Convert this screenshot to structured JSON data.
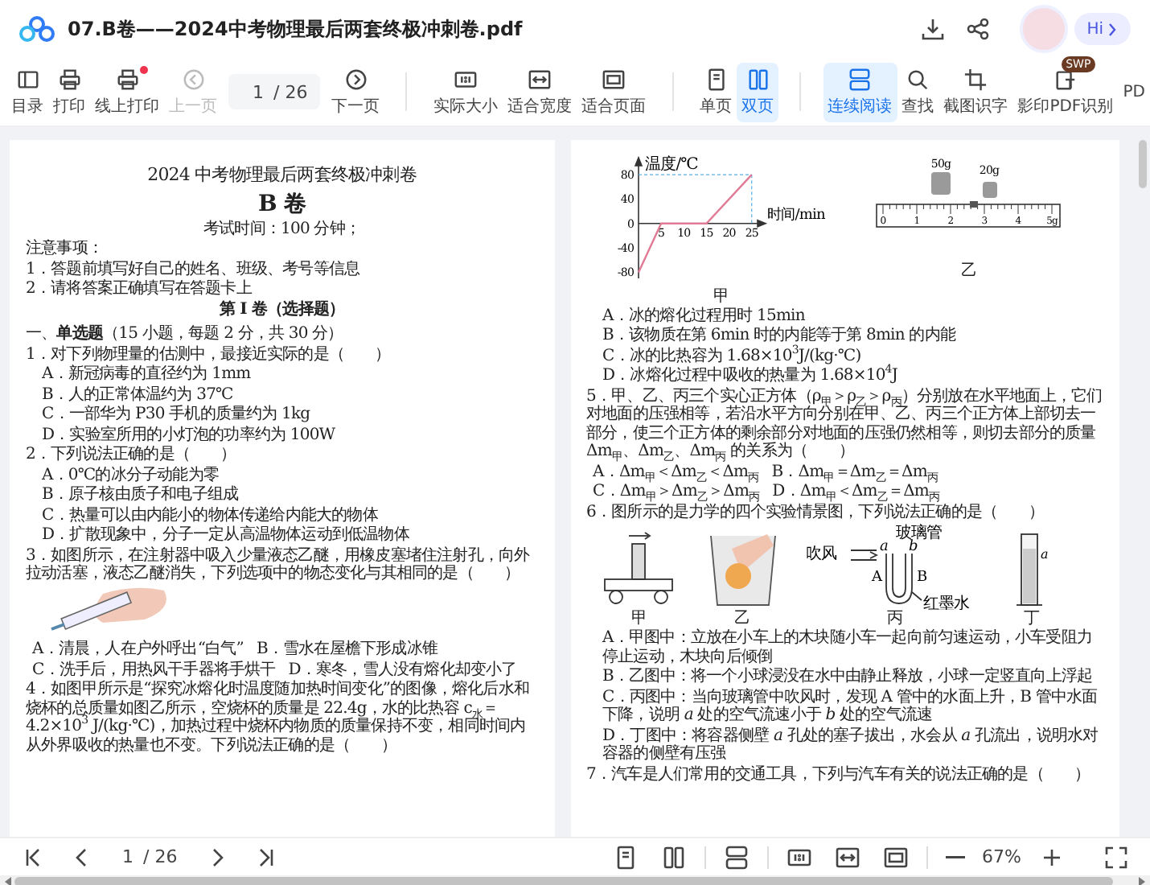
{
  "window": {
    "title": "07.B卷——2024中考物理最后两套终极冲刺卷.pdf",
    "greeting": "Hi"
  },
  "toolbar_groups": [
    {
      "items": [
        {
          "kind": "contents",
          "label": "目录",
          "selected": false,
          "disabled": false
        },
        {
          "kind": "print",
          "label": "打印",
          "selected": false,
          "disabled": false
        },
        {
          "kind": "online-print",
          "label": "线上打印",
          "selected": false,
          "disabled": false,
          "notified": true
        },
        {
          "kind": "prev",
          "label": "上一页",
          "selected": false,
          "disabled": true
        },
        {
          "kind": "pagefield",
          "value": "1",
          "total": "/ 26"
        },
        {
          "kind": "next",
          "label": "下一页",
          "selected": false,
          "disabled": false
        }
      ]
    },
    {
      "items": [
        {
          "kind": "actual-size",
          "label": "实际大小",
          "selected": false,
          "disabled": false
        },
        {
          "kind": "fit-width",
          "label": "适合宽度",
          "selected": false,
          "disabled": false
        },
        {
          "kind": "fit-page",
          "label": "适合页面",
          "selected": false,
          "disabled": false
        }
      ]
    },
    {
      "items": [
        {
          "kind": "single",
          "label": "单页",
          "selected": false,
          "disabled": false
        },
        {
          "kind": "double",
          "label": "双页",
          "selected": true,
          "disabled": false
        }
      ]
    },
    {
      "items": [
        {
          "kind": "continuous",
          "label": "连续阅读",
          "selected": true,
          "disabled": false
        },
        {
          "kind": "find",
          "label": "查找",
          "selected": false,
          "disabled": false
        },
        {
          "kind": "ocr",
          "label": "截图识字",
          "selected": false,
          "disabled": false
        },
        {
          "kind": "copy-ocr",
          "label": "影印PDF识别",
          "selected": false,
          "disabled": false,
          "badge": "SWP"
        },
        {
          "kind": "cut",
          "label": "PD",
          "selected": false,
          "disabled": false
        }
      ]
    }
  ],
  "left_page": [
    {
      "kind": "title",
      "text": "2024 中考物理最后两套终极冲刺卷"
    },
    {
      "kind": "subtitle",
      "text": "B 卷"
    },
    {
      "kind": "meta",
      "text": "考试时间：100 分钟；"
    },
    {
      "kind": "text",
      "text": "注意事项："
    },
    {
      "kind": "text",
      "text": "1．答题前填写好自己的姓名、班级、考号等信息"
    },
    {
      "kind": "text",
      "text": "2．请将答案正确填写在答题卡上"
    },
    {
      "kind": "section",
      "text": "第 I 卷（选择题）"
    },
    {
      "kind": "heading",
      "text": "一、**单选题**（15 小题，每题 2 分，共 30 分）"
    },
    {
      "kind": "question",
      "text": "1．对下列物理量的估测中，最接近实际的是（　　）"
    },
    {
      "kind": "option",
      "text": "A．新冠病毒的直径约为 1mm"
    },
    {
      "kind": "option",
      "text": "B．人的正常体温约为 37℃"
    },
    {
      "kind": "option",
      "text": "C．一部华为 P30 手机的质量约为 1kg"
    },
    {
      "kind": "option",
      "text": "D．实验室所用的小灯泡的功率约为 100W"
    },
    {
      "kind": "question",
      "text": "2．下列说法正确的是（　　）"
    },
    {
      "kind": "option",
      "text": "A．0℃的冰分子动能为零"
    },
    {
      "kind": "option",
      "text": "B．原子核由质子和电子组成"
    },
    {
      "kind": "option",
      "text": "C．热量可以由内能小的物体传递给内能大的物体"
    },
    {
      "kind": "option",
      "text": "D．扩散现象中，分子一定从高温物体运动到低温物体"
    },
    {
      "kind": "question",
      "text": "3．如图所示，在注射器中吸入少量液态乙醚，用橡皮塞堵住注射孔，向外拉动活塞，液态乙醚消失，下列选项中的物态变化与其相同的是（　　）"
    },
    {
      "kind": "syringe"
    },
    {
      "kind": "option-pair",
      "texts": [
        "A．清晨，人在户外呼出“白气”",
        "B．雪水在屋檐下形成冰锥"
      ]
    },
    {
      "kind": "option-pair",
      "texts": [
        "C．洗手后，用热风干手器将手烘干",
        "D．寒冬，雪人没有熔化却变小了"
      ]
    },
    {
      "kind": "question",
      "text": "4．如图甲所示是“探究冰熔化时温度随加热时间变化”的图像，熔化后水和烧杯的总质量如图乙所示，空烧杯的质量是 22.4g，水的比热容 c$_{水}$＝4.2×10$^{3}$ J/(kg·℃)，加热过程中烧杯内物质的质量保持不变，相同时间内从外界吸收的热量也不变。下列说法正确的是（　　）"
    }
  ],
  "right_page": [
    {
      "kind": "q4-figures",
      "chart_caption": "甲",
      "chart_data": {
        "type": "line",
        "xlabel": "时间/min",
        "ylabel": "温度/℃",
        "x": [
          0,
          5,
          15,
          25
        ],
        "series": [
          {
            "color": "#e07a95",
            "values": [
              -80,
              0,
              0,
              80
            ]
          }
        ],
        "xticks": [
          5,
          10,
          15,
          20,
          25
        ],
        "yticks": [
          -80,
          -40,
          0,
          40,
          80
        ],
        "xlim": [
          0,
          27
        ],
        "ylim": [
          -90,
          100
        ],
        "ref_lines": [
          {
            "axis": "y",
            "value": 80
          },
          {
            "axis": "x",
            "value": 25
          }
        ]
      },
      "weights": [
        "50g",
        "20g"
      ],
      "ruler_marks": [
        "0",
        "1",
        "2",
        "3",
        "4",
        "5g"
      ],
      "scale_caption": "乙"
    },
    {
      "kind": "option",
      "text": "A．冰的熔化过程用时 15min"
    },
    {
      "kind": "option",
      "text": "B．该物质在第 6min 时的内能等于第 8min 的内能"
    },
    {
      "kind": "option",
      "text": "C．冰的比热容为 1.68×10$^{3}$J/(kg·℃)"
    },
    {
      "kind": "option",
      "text": "D．冰熔化过程中吸收的热量为 1.68×10$^{4}$J"
    },
    {
      "kind": "question",
      "text": "5．甲、乙、丙三个实心正方体（ρ$_{甲}$＞ρ$_{乙}$＞ρ$_{丙}$）分别放在水平地面上，它们对地面的压强相等，若沿水平方向分别在甲、乙、丙三个正方体上部切去一部分，使三个正方体的剩余部分对地面的压强仍然相等，则切去部分的质量 Δm$_{甲}$、Δm$_{乙}$、Δm$_{丙}$ 的关系为（　　）"
    },
    {
      "kind": "option-pair",
      "texts": [
        "A．Δm$_{甲}$＜Δm$_{乙}$＜Δm$_{丙}$",
        "B．Δm$_{甲}$＝Δm$_{乙}$＝Δm$_{丙}$"
      ]
    },
    {
      "kind": "option-pair",
      "texts": [
        "C．Δm$_{甲}$＞Δm$_{乙}$＞Δm$_{丙}$",
        "D．Δm$_{甲}$＜Δm$_{乙}$＝Δm$_{丙}$"
      ]
    },
    {
      "kind": "question",
      "text": "6．图所示的是力学的四个实验情景图，下列说法正确的是（　　）"
    },
    {
      "kind": "experiments",
      "panels": [
        {
          "kind": "cart",
          "caption": "甲"
        },
        {
          "kind": "beaker",
          "caption": "乙"
        },
        {
          "kind": "utube",
          "caption": "丙",
          "labels": [
            "玻璃管",
            "吹风",
            "a",
            "b",
            "A",
            "B",
            "红墨水"
          ]
        },
        {
          "kind": "cylinder",
          "caption": "丁",
          "labels": [
            "a"
          ]
        }
      ]
    },
    {
      "kind": "option",
      "text": "A．甲图中：立放在小车上的木块随小车一起向前匀速运动，小车受阻力停止运动，木块向后倾倒"
    },
    {
      "kind": "option",
      "text": "B．乙图中：将一个小球浸没在水中由静止释放，小球一定竖直向上浮起"
    },
    {
      "kind": "option",
      "text": "C．丙图中：当向玻璃管中吹风时，发现 A 管中的水面上升，B 管中水面下降，说明 *a* 处的空气流速小于 *b* 处的空气流速"
    },
    {
      "kind": "option",
      "text": "D．丁图中：将容器侧壁 *a* 孔处的塞子拔出，水会从 *a* 孔流出，说明水对容器的侧壁有压强"
    },
    {
      "kind": "question",
      "text": "7．汽车是人们常用的交通工具，下列与汽车有关的说法正确的是（　　）"
    }
  ],
  "bottom_bar": {
    "nav_left": [
      {
        "kind": "first"
      },
      {
        "kind": "prev"
      }
    ],
    "page": {
      "value": "1",
      "total": "/ 26"
    },
    "nav_right": [
      {
        "kind": "next"
      },
      {
        "kind": "last"
      }
    ],
    "view_buttons": [
      {
        "kind": "single",
        "selected": false
      },
      {
        "kind": "double",
        "selected": false
      },
      {
        "kind": "continuous",
        "selected": false
      },
      {
        "kind": "actual-size",
        "selected": false
      },
      {
        "kind": "fit-width",
        "selected": false
      },
      {
        "kind": "fit-page",
        "selected": false
      }
    ],
    "zoom": "67%"
  }
}
